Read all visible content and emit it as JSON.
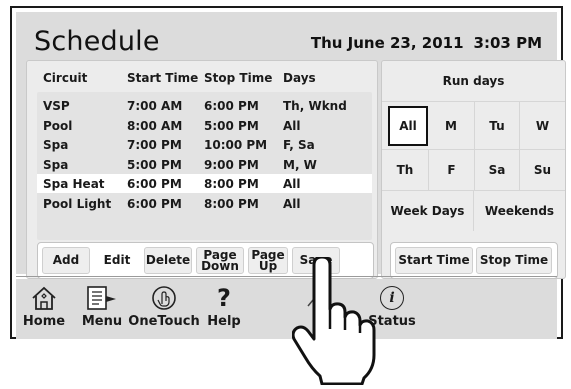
{
  "header": {
    "title": "Schedule",
    "date": "Thu June 23, 2011",
    "time": "3:03 PM"
  },
  "table": {
    "columns": [
      "Circuit",
      "Start Time",
      "Stop Time",
      "Days"
    ],
    "rows": [
      {
        "circuit": "VSP",
        "start": "7:00 AM",
        "stop": "6:00 PM",
        "days": "Th, Wknd"
      },
      {
        "circuit": "Pool",
        "start": "8:00 AM",
        "stop": "5:00 PM",
        "days": "All"
      },
      {
        "circuit": "Spa",
        "start": "7:00 PM",
        "stop": "10:00 PM",
        "days": "F, Sa"
      },
      {
        "circuit": "Spa",
        "start": "5:00 PM",
        "stop": "9:00 PM",
        "days": "M, W"
      },
      {
        "circuit": "Spa Heat",
        "start": "6:00 PM",
        "stop": "8:00 PM",
        "days": "All"
      },
      {
        "circuit": "Pool Light",
        "start": "6:00 PM",
        "stop": "8:00 PM",
        "days": "All"
      }
    ]
  },
  "actions": {
    "add": "Add",
    "edit": "Edit",
    "delete": "Delete",
    "page_down_1": "Page",
    "page_down_2": "Down",
    "page_up_1": "Page",
    "page_up_2": "Up",
    "save": "Save"
  },
  "run_days": {
    "title": "Run days",
    "days_row1": [
      "All",
      "M",
      "Tu",
      "W"
    ],
    "days_row2": [
      "Th",
      "F",
      "Sa",
      "Su"
    ],
    "week_days": "Week Days",
    "weekends": "Weekends",
    "start_time": "Start Time",
    "stop_time": "Stop Time"
  },
  "nav": {
    "home": "Home",
    "menu": "Menu",
    "onetouch": "OneTouch",
    "help": "Help",
    "status": "Status",
    "help_glyph": "?",
    "status_glyph": "i"
  }
}
